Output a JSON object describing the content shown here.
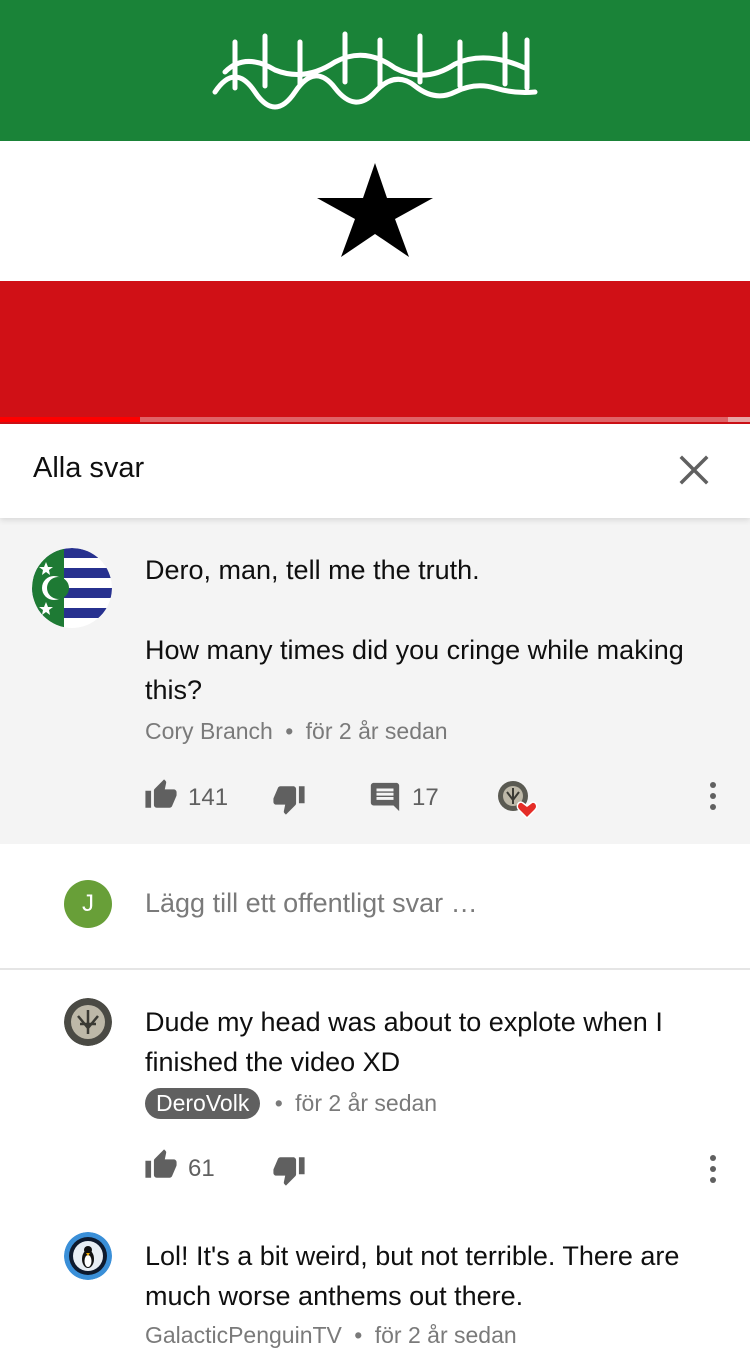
{
  "video": {
    "flag_colors": {
      "green": "#1a8338",
      "white": "#ffffff",
      "red": "#d01016",
      "star": "#000000"
    },
    "progress_percent": 18.7
  },
  "header": {
    "title": "Alla svar",
    "close_icon": "close-icon"
  },
  "main_comment": {
    "text_line1": "Dero, man, tell me the truth.",
    "text_line2": "How many times did you cringe while making this?",
    "author": "Cory Branch",
    "separator": "•",
    "time": "för 2 år sedan",
    "likes": "141",
    "replies": "17"
  },
  "reply_box": {
    "avatar_letter": "J",
    "placeholder": "Lägg till ett offentligt svar …"
  },
  "replies": [
    {
      "text": "Dude my head was about to explote when I finished the video XD",
      "author": "DeroVolk",
      "separator": "•",
      "time": "för 2 år sedan",
      "likes": "61"
    },
    {
      "text": "Lol! It's a bit weird, but not terrible. There are much worse anthems out there.",
      "author": "GalacticPenguinTV",
      "separator": "•",
      "time": "för 2 år sedan"
    }
  ]
}
